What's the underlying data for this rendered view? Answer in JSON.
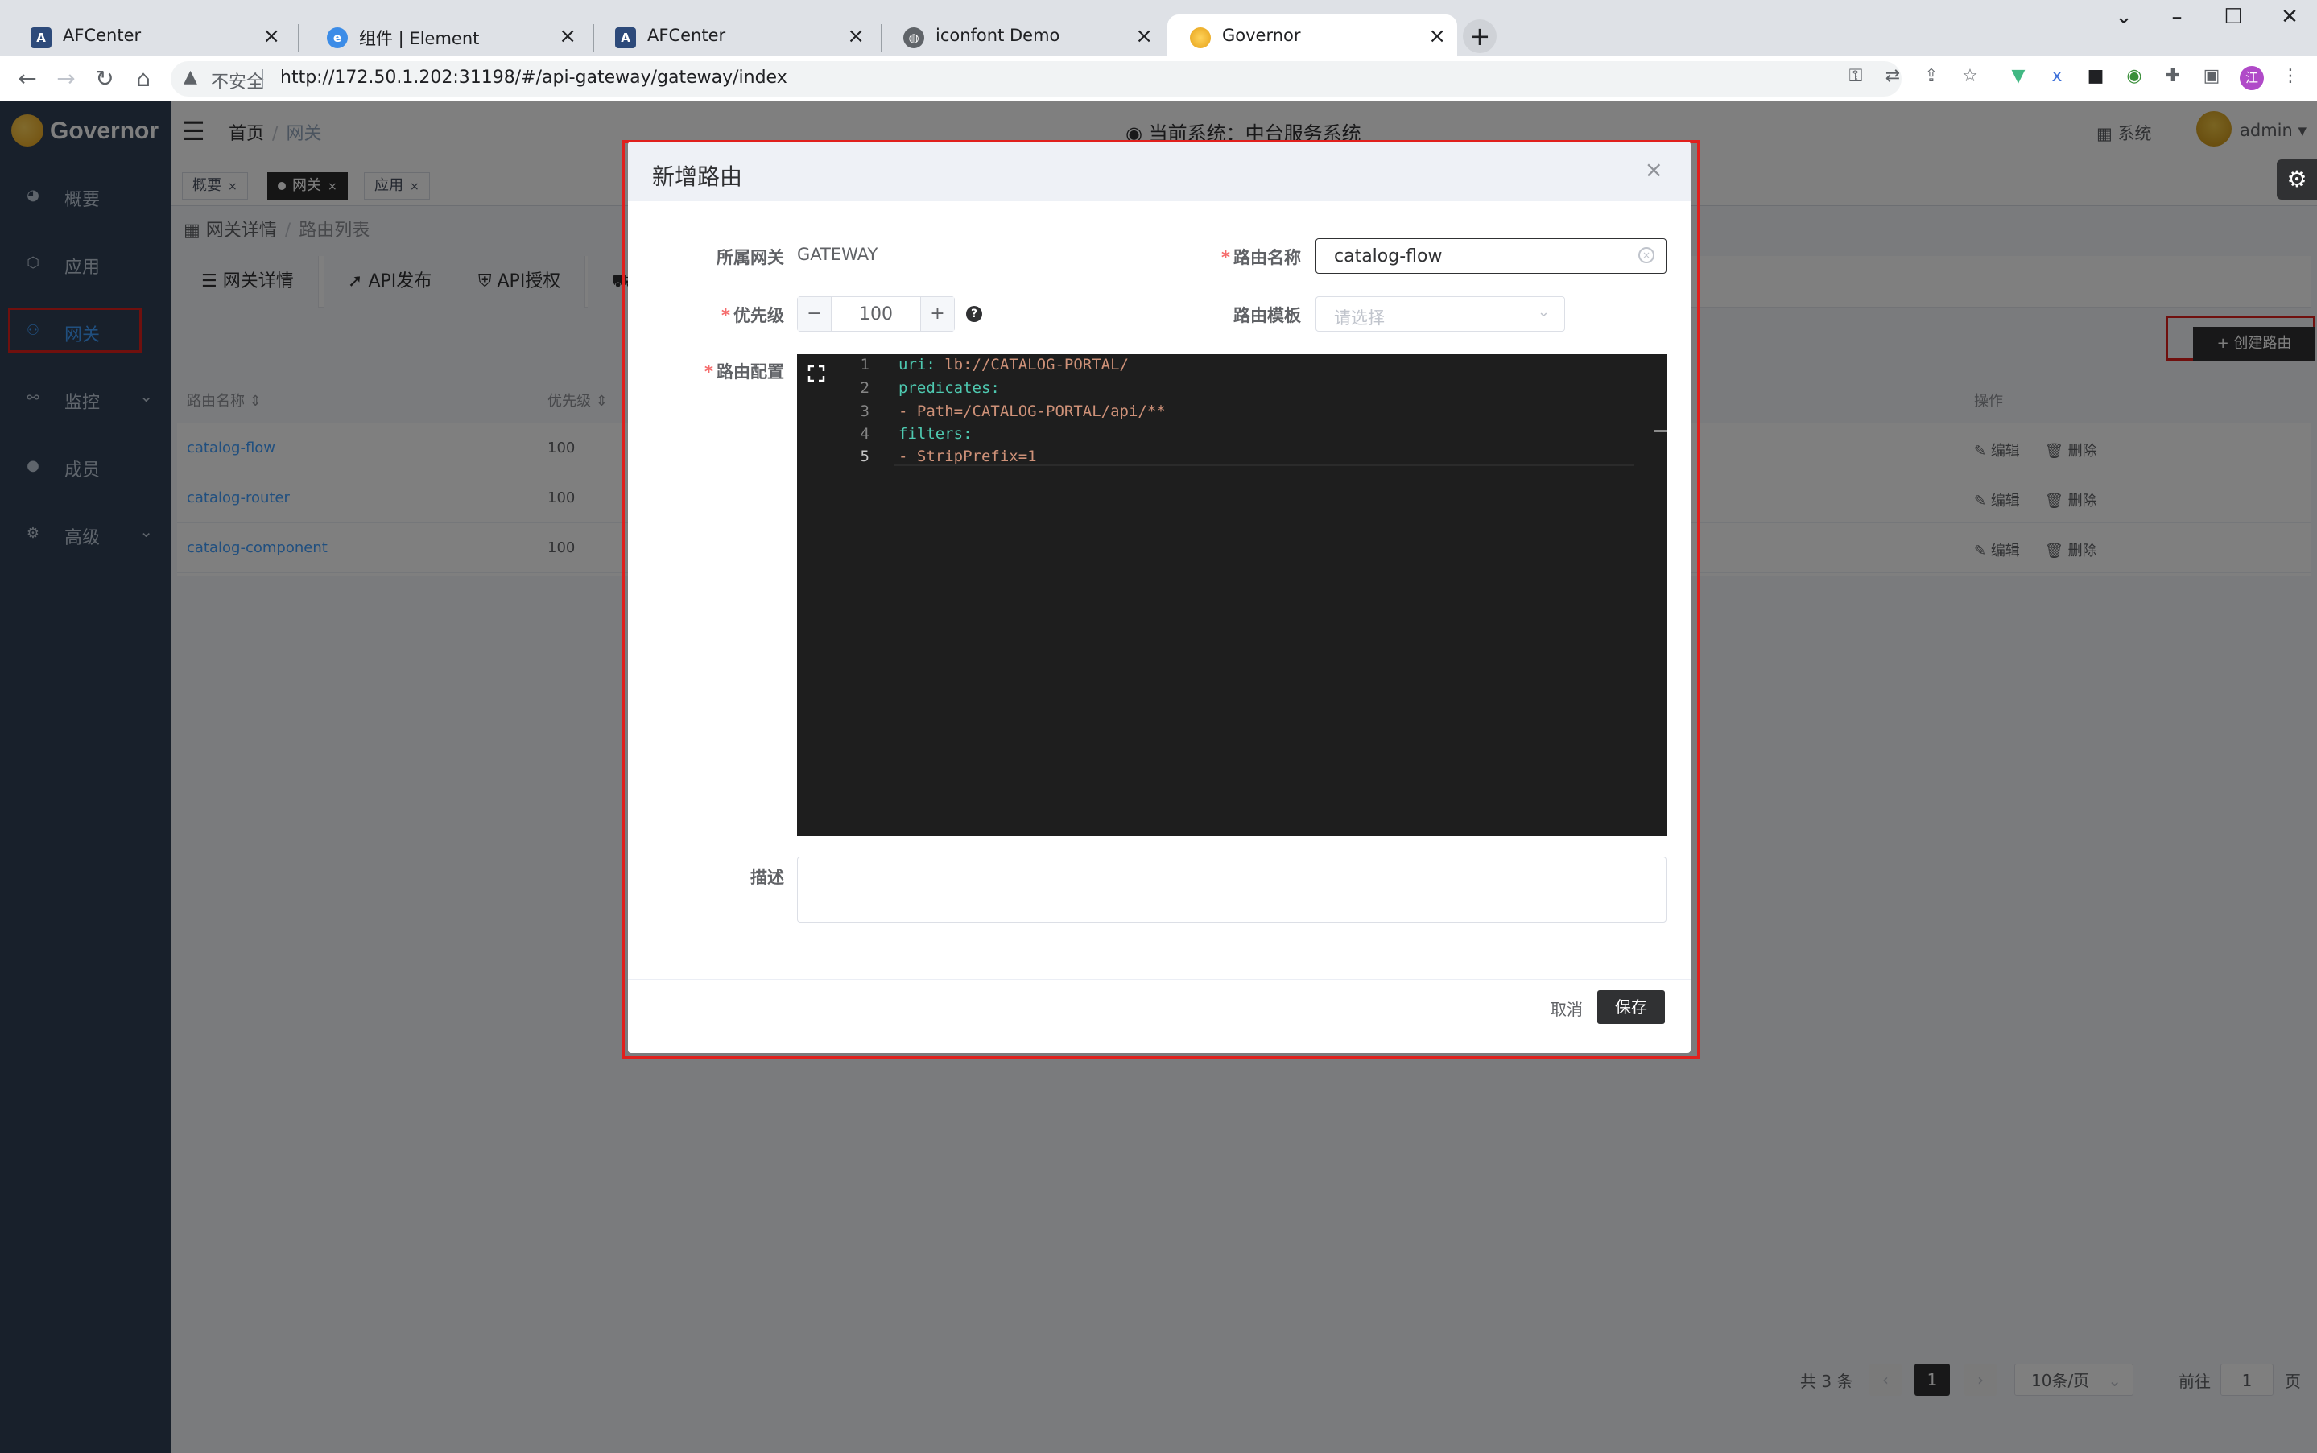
{
  "browser": {
    "tabs": [
      {
        "title": "AFCenter",
        "fav": "af-icon"
      },
      {
        "title": "组件 | Element",
        "fav": "element-icon"
      },
      {
        "title": "AFCenter",
        "fav": "af-icon"
      },
      {
        "title": "iconfont Demo",
        "fav": "globe-icon"
      },
      {
        "title": "Governor",
        "fav": "governor-icon"
      }
    ],
    "new_tab": "+",
    "security_label": "不安全",
    "url": "http://172.50.1.202:31198/#/api-gateway/gateway/index",
    "profile_initial": "江"
  },
  "sidebar": {
    "logo_text": "Governor",
    "items": [
      {
        "label": "概要",
        "icon": "dashboard-icon"
      },
      {
        "label": "应用",
        "icon": "cube-icon"
      },
      {
        "label": "网关",
        "icon": "gateway-icon"
      },
      {
        "label": "监控",
        "icon": "monitor-icon"
      },
      {
        "label": "成员",
        "icon": "user-icon"
      },
      {
        "label": "高级",
        "icon": "gears-icon"
      }
    ]
  },
  "navbar": {
    "breadcrumb": [
      "首页",
      "网关"
    ],
    "current_system": "当前系统：中台服务系统",
    "system_label": "系统",
    "user": "admin"
  },
  "tagsview": {
    "tags": [
      "概要",
      "网关",
      "应用"
    ],
    "close": "×"
  },
  "page": {
    "breadcrumb": [
      "网关详情",
      "路由列表"
    ],
    "tabs": [
      "网关详情",
      "API发布",
      "API授权"
    ],
    "create_button": "创建路由",
    "table": {
      "headers": [
        "路由名称",
        "优先级",
        "操作"
      ],
      "rows": [
        {
          "name": "catalog-flow",
          "priority": "100"
        },
        {
          "name": "catalog-router",
          "priority": "100"
        },
        {
          "name": "catalog-component",
          "priority": "100"
        }
      ],
      "edit": "编辑",
      "delete": "删除"
    },
    "pager": {
      "total": "共 3 条",
      "current_page": "1",
      "page_size": "10条/页",
      "goto": "前往",
      "goto_value": "1",
      "page_unit": "页"
    }
  },
  "dialog": {
    "title": "新增路由",
    "gateway_label": "所属网关",
    "gateway_value": "GATEWAY",
    "name_label": "路由名称",
    "name_value": "catalog-flow",
    "priority_label": "优先级",
    "priority_value": "100",
    "template_label": "路由模板",
    "template_placeholder": "请选择",
    "config_label": "路由配置",
    "code_lines": [
      {
        "no": "1",
        "key": "uri:",
        "val": " lb://CATALOG-PORTAL/"
      },
      {
        "no": "2",
        "key": "predicates:",
        "val": ""
      },
      {
        "no": "3",
        "key": "",
        "val": "- Path=/CATALOG-PORTAL/api/**"
      },
      {
        "no": "4",
        "key": "filters:",
        "val": ""
      },
      {
        "no": "5",
        "key": "",
        "val": "- StripPrefix=1"
      }
    ],
    "desc_label": "描述",
    "cancel": "取消",
    "save": "保存"
  }
}
